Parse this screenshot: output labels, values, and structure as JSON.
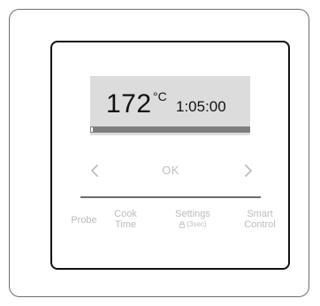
{
  "display": {
    "temperature": "172",
    "temperature_unit": "°C",
    "time": "1:05:00",
    "progress_percent": 1
  },
  "navigation": {
    "left_icon": "chevron-left-icon",
    "ok_label": "OK",
    "right_icon": "chevron-right-icon"
  },
  "buttons": {
    "probe": "Probe",
    "cook_line1": "Cook",
    "cook_line2": "Time",
    "settings": "Settings",
    "settings_sub": "(3sec)",
    "settings_sub_icon": "lock-icon",
    "smart_line1": "Smart",
    "smart_line2": "Control"
  },
  "colors": {
    "display_background": "#dcdcdc",
    "muted_text": "#bcbcbc",
    "frame": "#111111"
  }
}
